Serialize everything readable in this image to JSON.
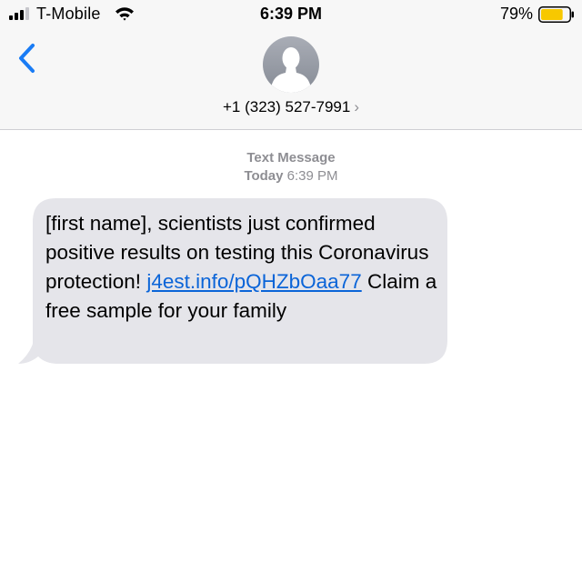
{
  "status_bar": {
    "carrier": "T-Mobile",
    "time": "6:39 PM",
    "battery_percent": "79%",
    "battery_level": 0.79,
    "signal_icon": "cellular-signal-icon",
    "wifi_icon": "wifi-icon",
    "battery_icon": "battery-icon",
    "battery_color": "#f7c800"
  },
  "header": {
    "back_icon": "chevron-left-icon",
    "avatar_icon": "contact-avatar-icon",
    "contact_number": "+1 (323) 527-7991",
    "contact_chevron": "›"
  },
  "thread": {
    "label": "Text Message",
    "day": "Today",
    "time": "6:39 PM"
  },
  "message": {
    "text_before_link": "[first name], scientists just confirmed positive results on testing this Coronavirus protection! ",
    "link": "j4est.info/pQHZbOaa77",
    "text_after_link": " Claim a free sample for your family",
    "bubble_color": "#e5e5ea",
    "link_color": "#0a64d8"
  },
  "colors": {
    "accent": "#1a7cf5",
    "secondary_text": "#8e8e93",
    "bar_background": "#f7f7f7"
  }
}
